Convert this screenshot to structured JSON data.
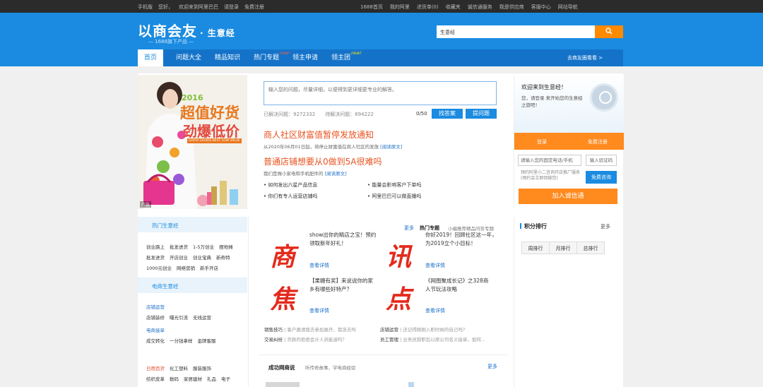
{
  "topbar": {
    "left": [
      "手机版",
      "您好，",
      "欢迎来到阿里巴巴",
      "请登录",
      "免费注册"
    ],
    "right": [
      "1688首页",
      "我的阿里",
      "进货单(0)",
      "收藏夹",
      "诚信通服务",
      "我是供应商",
      "客服中心",
      "网站导航"
    ]
  },
  "header": {
    "logo": "以商会友",
    "logo_sub": "· 生意经",
    "tagline": "— 1688旗下产品 —",
    "search_select": "生意经",
    "search_placeholder": "",
    "search_icon": "search-icon"
  },
  "nav": {
    "items": [
      "首页",
      "问题大全",
      "精品知识",
      "热门专题",
      "领主申请",
      "领主团"
    ],
    "new_badge": "new!",
    "right_link": "去商友圈看看 >"
  },
  "banner": {
    "year": "2016",
    "headline1": "超值好货",
    "headline2": "劲爆低价",
    "en": "GOOD GOODS BEST LOW VALUE",
    "ad_label": "广告"
  },
  "question": {
    "placeholder": "输入您的问题，尽量详细，以便得到更详细更专业的解答。",
    "solved": "已解决问题：9272332",
    "pending": "待解决问题：894222",
    "counter": "0/50",
    "find_btn": "找答案",
    "ask_btn": "提问题"
  },
  "news": [
    {
      "title": "商人社区财富值暂停发放通知",
      "desc": "从2020年06月01日起，将停止财富值在商人社区的发放",
      "link": "[阅读原文]"
    },
    {
      "title": "普通店铺想要从0做到5A很难吗",
      "desc": "我们是做小家电和手机配件的",
      "link": "[阅读原文]"
    }
  ],
  "bullets": [
    "如何发出六星产品信息",
    "能量会影响客户下单吗",
    "你们有专人运营店铺吗",
    "阿里巴巴可以做直播吗"
  ],
  "login": {
    "hello": "欢迎来到生意经！",
    "tip": "您，请登录 来开始您的生意经之旅吧！",
    "login_btn": "登录",
    "register_btn": "免费注册",
    "phone_placeholder": "请输入您的固定电话/手机",
    "code_btn": "输入验证码",
    "hint": "预约阿里小二咨询开店推广服务(预约会立即回拨您)",
    "consult_btn": "免费咨询",
    "join_btn": "加入诚信通"
  },
  "sidebar": {
    "sec1": "热门生意经",
    "rows1": [
      [
        "创业路上",
        "批发进货",
        "1-5万创业",
        "摆地摊"
      ],
      [
        "批发进货",
        "开店创业",
        "创业宝典",
        "新奇特"
      ],
      [
        "1000元创业",
        "网络营销",
        "新手开店"
      ]
    ],
    "sec2": "电商生意经",
    "cat1": "店铺运营",
    "rows2a": [
      "店铺装修",
      "曝光引流",
      "无线运营"
    ],
    "cat2": "电商接单",
    "rows2b": [
      "成交转化",
      "一分钱拿样",
      "金牌客服"
    ],
    "rows3a": [
      "日用百货",
      "化工塑料",
      "服装服饰"
    ],
    "rows3b": [
      "纺织皮革",
      "数码",
      "家居建材",
      "礼品",
      "电子"
    ]
  },
  "hot": {
    "chars": [
      "商",
      "焦",
      "讯",
      "点"
    ],
    "articles": [
      "show出你的精店之宝！预约领取新年好礼！",
      "你好2019！回顾社区这一年，为2019立个小目标！",
      "【果糖有奖】来说说你的家乡有哪些好特产？",
      "《网图聚成长记》之328商人节玩法攻略"
    ],
    "view": "查看详情",
    "more": "更多",
    "topic_title": "热门专题",
    "topic_desc": "小编推荐精品问答专题",
    "lines": [
      {
        "k": "销售技巧",
        "v": "客户邀请我去参加展开，我该去吗"
      },
      {
        "k": "店铺运营",
        "v": "还记得刚刚入职时候的自己吗？"
      },
      {
        "k": "交易纠纷",
        "v": "货款的拒绝会计人员能退吗？"
      },
      {
        "k": "员工管理",
        "v": "业务员辞职后以原公司名义接单，如何..."
      }
    ],
    "success_title": "成功网商说",
    "success_desc": "听传奇故事，学电商经验",
    "success_more": "更多"
  },
  "rank": {
    "title": "积分排行",
    "more": "更多",
    "tabs": [
      "周排行",
      "月排行",
      "总排行"
    ]
  }
}
